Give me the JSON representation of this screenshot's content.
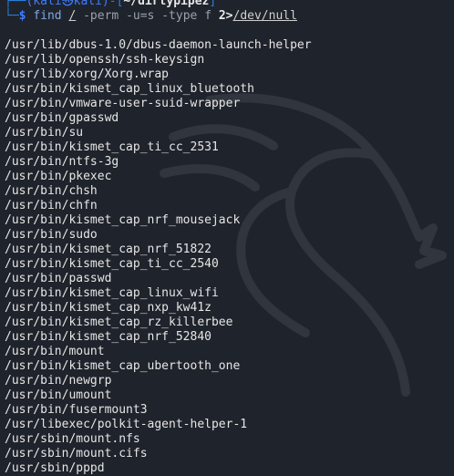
{
  "prompt": {
    "user_host": "(kali㉿kali)",
    "dir_open": "-[",
    "dir": "~/dirtypipez",
    "dir_close": "]",
    "branch": "└─",
    "dollar": "$",
    "command": "find",
    "arg_root": "/",
    "opt_perm": "-perm",
    "opt_mode": "-u=s",
    "opt_type": "-type",
    "opt_f": "f",
    "redir": "2>",
    "devnull": "/dev/null"
  },
  "output": [
    "/usr/lib/dbus-1.0/dbus-daemon-launch-helper",
    "/usr/lib/openssh/ssh-keysign",
    "/usr/lib/xorg/Xorg.wrap",
    "/usr/bin/kismet_cap_linux_bluetooth",
    "/usr/bin/vmware-user-suid-wrapper",
    "/usr/bin/gpasswd",
    "/usr/bin/su",
    "/usr/bin/kismet_cap_ti_cc_2531",
    "/usr/bin/ntfs-3g",
    "/usr/bin/pkexec",
    "/usr/bin/chsh",
    "/usr/bin/chfn",
    "/usr/bin/kismet_cap_nrf_mousejack",
    "/usr/bin/sudo",
    "/usr/bin/kismet_cap_nrf_51822",
    "/usr/bin/kismet_cap_ti_cc_2540",
    "/usr/bin/passwd",
    "/usr/bin/kismet_cap_linux_wifi",
    "/usr/bin/kismet_cap_nxp_kw41z",
    "/usr/bin/kismet_cap_rz_killerbee",
    "/usr/bin/kismet_cap_nrf_52840",
    "/usr/bin/mount",
    "/usr/bin/kismet_cap_ubertooth_one",
    "/usr/bin/newgrp",
    "/usr/bin/umount",
    "/usr/bin/fusermount3",
    "/usr/libexec/polkit-agent-helper-1",
    "/usr/sbin/mount.nfs",
    "/usr/sbin/mount.cifs",
    "/usr/sbin/pppd"
  ],
  "colors": {
    "background": "#1f232b",
    "prompt_blue": "#2c7fd8",
    "text": "#e6e6e6"
  },
  "watermark_icon": "kali-dragon-icon"
}
